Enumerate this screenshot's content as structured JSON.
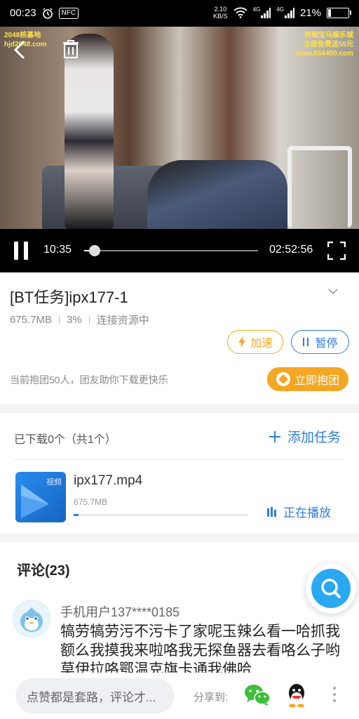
{
  "status_bar": {
    "time": "00:23",
    "nfc": "NFC",
    "net_speed_value": "2.10",
    "net_speed_unit": "KB/S",
    "signal1": "4G",
    "signal2": "4G",
    "battery": "21%",
    "battery_level": 0.21
  },
  "video": {
    "watermark_left": [
      "2048核基地",
      "hjd2048.com"
    ],
    "watermark_right": [
      "奔驰宝马娱乐城",
      "注册免费送55元",
      "www.554400.com"
    ],
    "current_time": "10:35",
    "total_time": "02:52:56",
    "progress": 0.06
  },
  "task": {
    "title": "[BT任务]ipx177-1",
    "size": "675.7MB",
    "percent": "3%",
    "status": "连接资源中",
    "accelerate_label": "加速",
    "pause_label": "暂停",
    "group_text": "当前抱团50人，团友助你下载更快乐",
    "join_label": "立即抱团"
  },
  "files": {
    "count_text": "已下载0个（共1个）",
    "add_task_label": "添加任务",
    "items": [
      {
        "type_label": "视频",
        "name": "ipx177.mp4",
        "size": "675.7MB",
        "progress": 0.03,
        "status": "正在播放"
      }
    ]
  },
  "comments": {
    "title": "评论(23)",
    "items": [
      {
        "user": "手机用户137****0185",
        "text": "犒劳犒劳污不污卡了家呢玉辣么看一哈抓我额么我摸我来啦咯我无探鱼器去看咯么子哟莫伊拉咯鄂温克旗卡通我佛哈"
      }
    ]
  },
  "bottom": {
    "comment_placeholder": "点赞都是套路，评论才...",
    "share_label": "分享到:"
  },
  "colors": {
    "accent_blue": "#2f7de1",
    "accent_orange": "#f5a623",
    "search_blue": "#2aa8f2"
  }
}
